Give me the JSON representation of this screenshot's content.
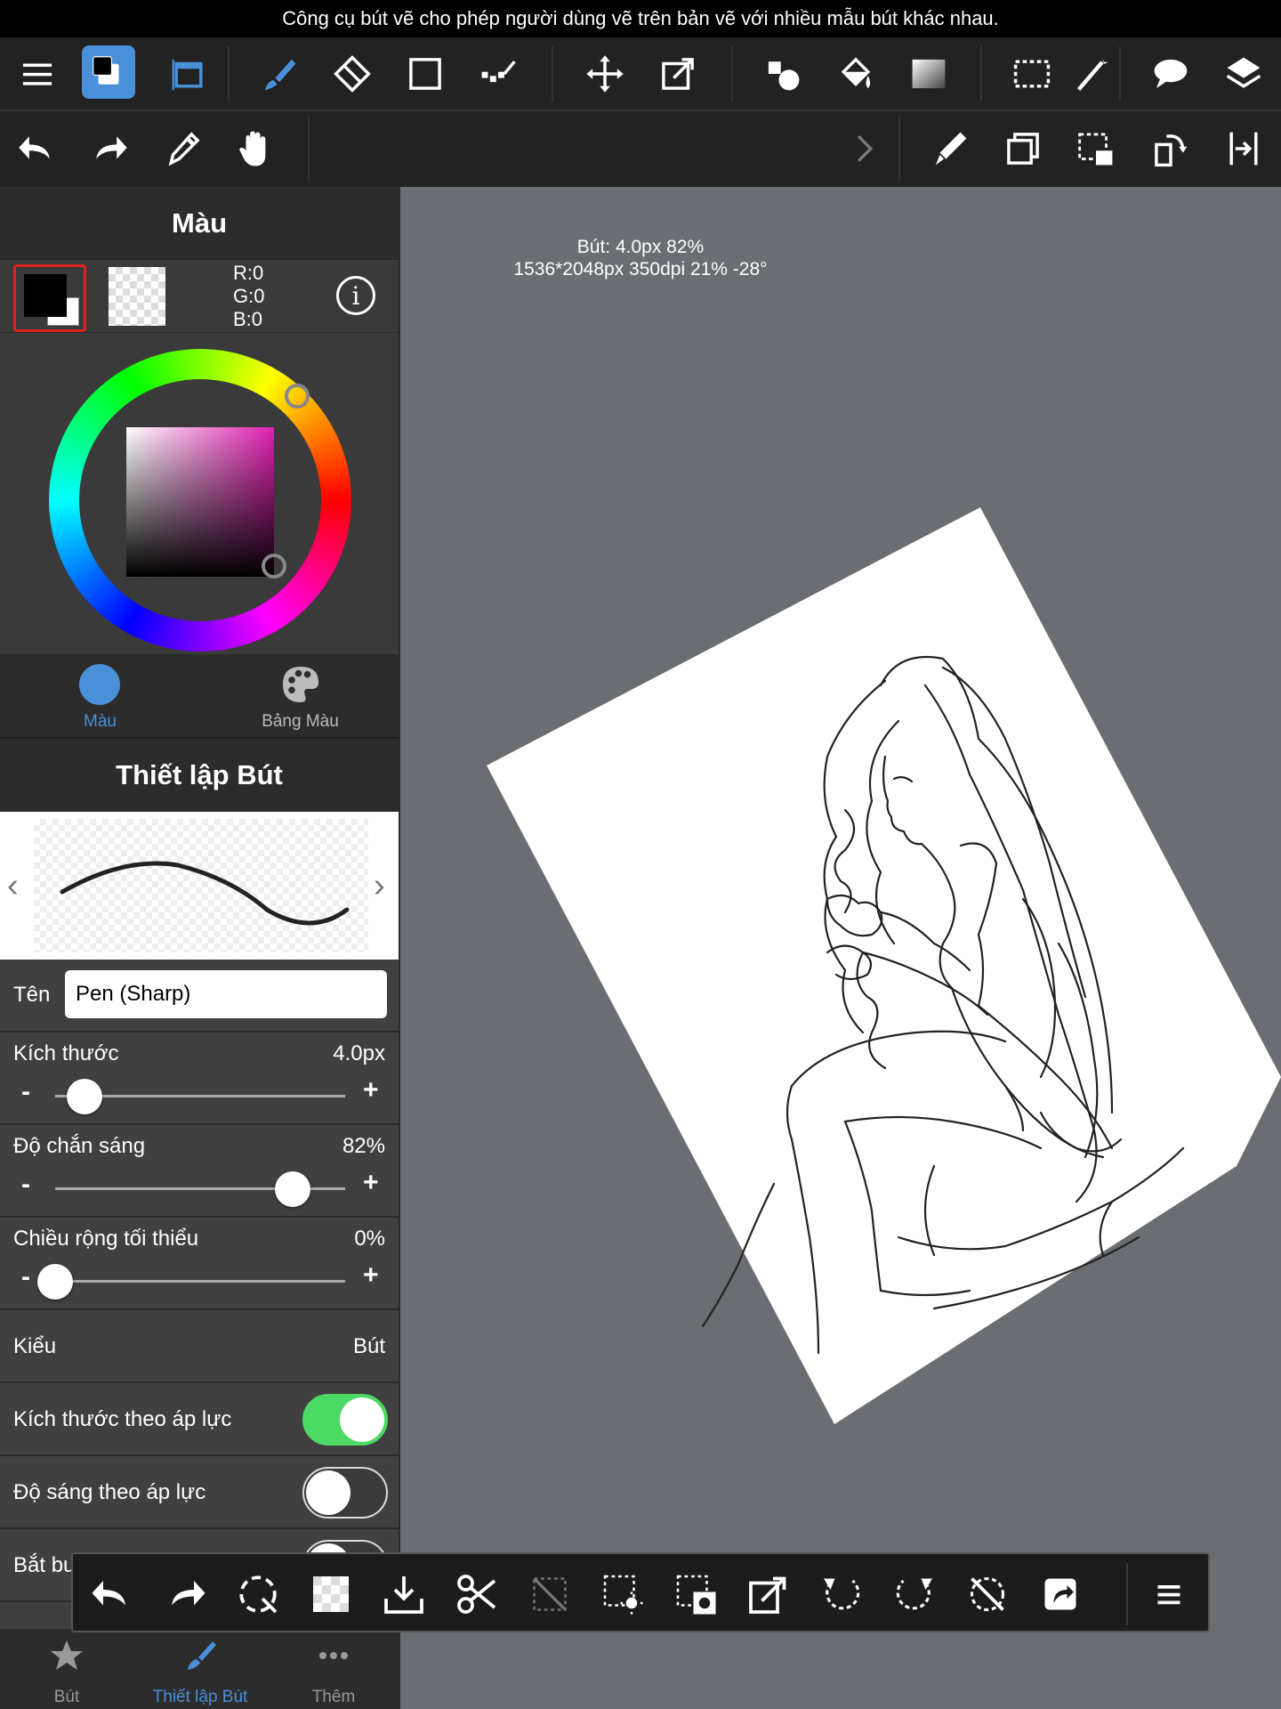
{
  "caption": "Công cụ bút vẽ cho phép người dùng vẽ trên bản vẽ với nhiều mẫu bút khác nhau.",
  "status": {
    "line1": "Bút: 4.0px 82%",
    "line2": "1536*2048px 350dpi 21% -28°"
  },
  "toolbar_top": [
    "menu-icon",
    "color-icon",
    "snap-icon",
    "brush-icon",
    "eraser-icon",
    "rect-icon",
    "dot-icon",
    "move-icon",
    "transform-icon",
    "shapes-icon",
    "fill-icon",
    "gradient-icon",
    "select-icon",
    "magic-wand-icon",
    "balloon-icon",
    "layers-icon"
  ],
  "toolbar_second": [
    "undo-icon",
    "redo-icon",
    "eyedropper-icon",
    "hand-icon",
    "next-chevron-icon",
    "pen-icon",
    "copy-layer-icon",
    "select-move-icon",
    "rotate-icon",
    "flip-icon"
  ],
  "color_panel": {
    "title": "Màu",
    "r": "R:0",
    "g": "G:0",
    "b": "B:0",
    "fg_color": "#000000",
    "bg_color": "transparent",
    "tabs": [
      {
        "label": "Màu",
        "active": true
      },
      {
        "label": "Bảng Màu",
        "active": false
      }
    ]
  },
  "pen_settings": {
    "title": "Thiết lập Bút",
    "name_label": "Tên",
    "name_value": "Pen (Sharp)",
    "size_label": "Kích thước",
    "size_value": "4.0px",
    "size_level": 0.1,
    "opacity_label": "Độ chắn sáng",
    "opacity_value": "82%",
    "opacity_level": 0.82,
    "minwidth_label": "Chiều rộng tối thiểu",
    "minwidth_value": "0%",
    "minwidth_level": 0.0,
    "type_label": "Kiểu",
    "type_value": "Bút",
    "pressure_size_label": "Kích thước theo áp lực",
    "pressure_size_on": true,
    "pressure_bright_label": "Độ sáng theo áp lực",
    "pressure_bright_on": false,
    "forced_label": "Bắt bu",
    "minus": "-",
    "plus": "+"
  },
  "bottom_tabs": [
    {
      "label": "Bút",
      "icon": "star-icon",
      "active": false
    },
    {
      "label": "Thiết lập Bút",
      "icon": "brush-icon",
      "active": true
    },
    {
      "label": "Thêm",
      "icon": "more-icon",
      "active": false
    }
  ],
  "floating_toolbar": [
    "undo-icon",
    "redo-icon",
    "deselect-icon",
    "clear-icon",
    "import-icon",
    "cut-icon",
    "hide-selection-icon",
    "select-light-icon",
    "select-fill-icon",
    "transform-icon",
    "rotate-left-icon",
    "rotate-right-icon",
    "reset-rotation-icon",
    "share-icon",
    "menu-icon"
  ],
  "colors": {
    "accent": "#4a90d9",
    "toggle_on": "#4cd964",
    "panel_bg": "#3f3f3f",
    "toolbar_bg": "#222222",
    "canvas_bg": "#6a6d72"
  }
}
